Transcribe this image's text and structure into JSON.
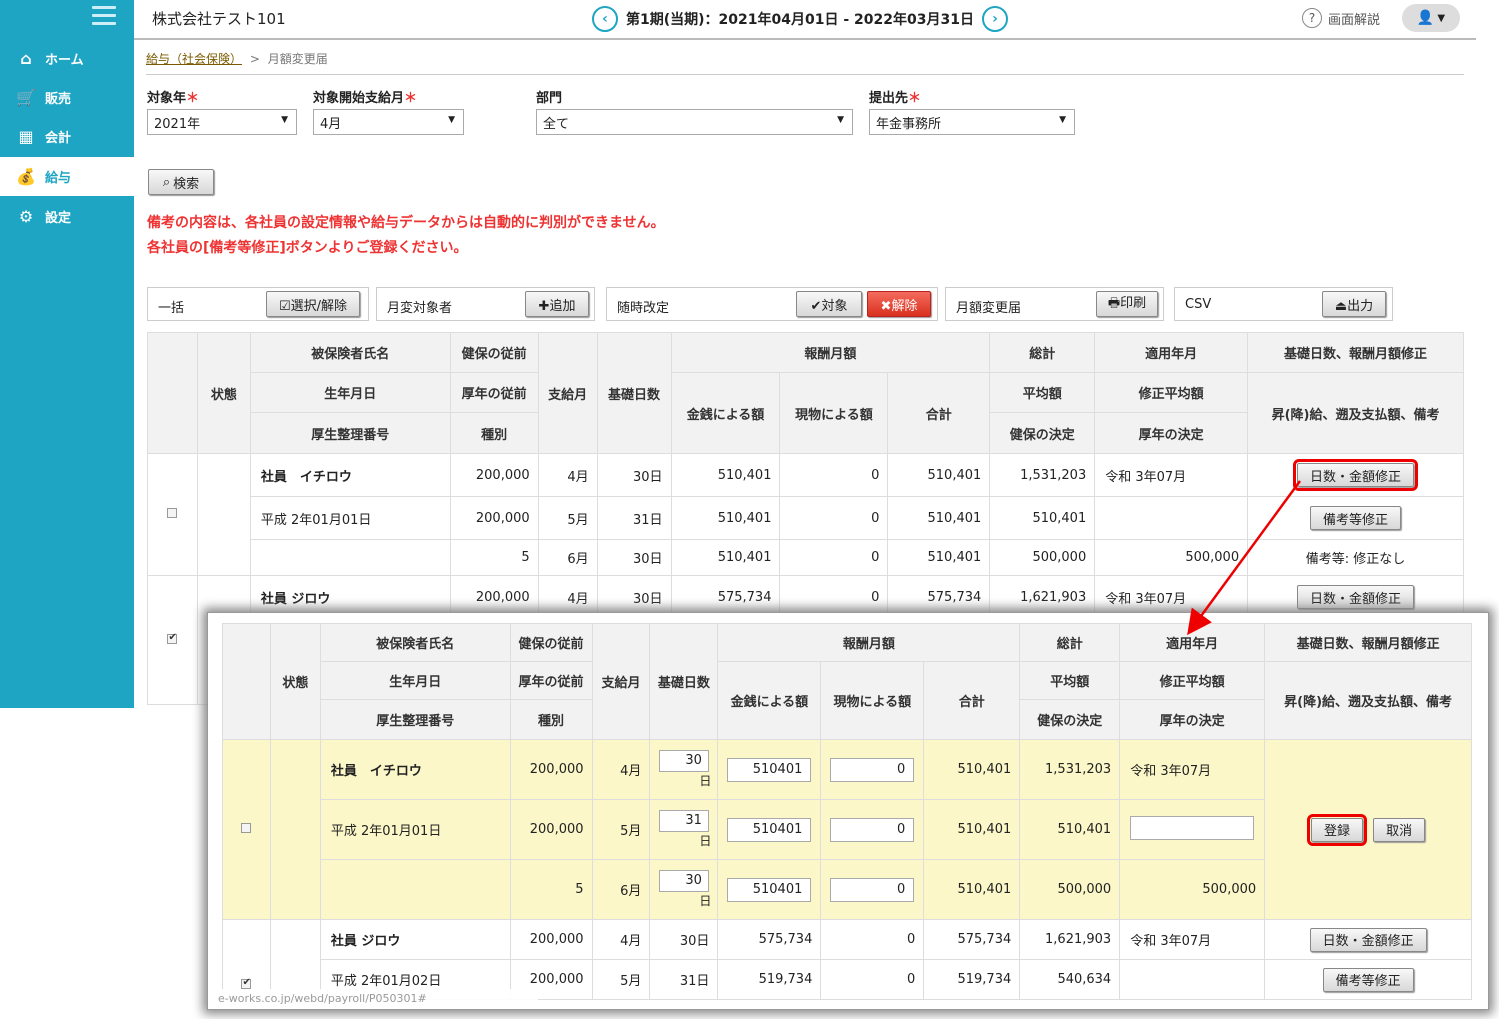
{
  "sidebar": {
    "items": [
      {
        "label": "ホーム",
        "icon": "home-icon"
      },
      {
        "label": "販売",
        "icon": "cart-icon"
      },
      {
        "label": "会計",
        "icon": "calculator-icon"
      },
      {
        "label": "給与",
        "icon": "money-bag-icon"
      },
      {
        "label": "設定",
        "icon": "gear-icon"
      }
    ]
  },
  "header": {
    "company": "株式会社テスト101",
    "period": "第1期(当期)：2021年04月01日 - 2022年03月31日",
    "help": "画面解説"
  },
  "breadcrumb": {
    "parent": "給与（社会保険）",
    "sep": ">",
    "current": "月額変更届"
  },
  "filters": {
    "year_label": "対象年",
    "year_value": "2021年",
    "month_label": "対象開始支給月",
    "month_value": "4月",
    "dept_label": "部門",
    "dept_value": "全て",
    "dest_label": "提出先",
    "dest_value": "年金事務所",
    "required_mark": "＊",
    "search": "検索"
  },
  "notice": {
    "line1": "備考の内容は、各社員の設定情報や給与データからは自動的に判別ができません。",
    "line2": "各社員の[備考等修正]ボタンよりご登録ください。"
  },
  "actions": {
    "bulk_label": "一括",
    "bulk_btn": "☑選択/解除",
    "target_label": "月変対象者",
    "target_btn": "✚追加",
    "revision_label": "随時改定",
    "revision_on": "✔対象",
    "revision_off": "✖解除",
    "form_label": "月額変更届",
    "form_btn": "🖶印刷",
    "csv_label": "CSV",
    "csv_btn": "⏏出力"
  },
  "table_headers": {
    "status": "状態",
    "name": "被保険者氏名",
    "birth": "生年月日",
    "number": "厚生整理番号",
    "kenpo_prev": "健保の従前",
    "kounen_prev": "厚年の従前",
    "kind": "種別",
    "pay_month": "支給月",
    "days": "基礎日数",
    "reward": "報酬月額",
    "cash": "金銭による額",
    "goods": "現物による額",
    "subtotal": "合計",
    "total": "総計",
    "avg": "平均額",
    "kenpo_dec": "健保の決定",
    "apply": "適用年月",
    "mod_avg": "修正平均額",
    "kounen_dec": "厚年の決定",
    "fix": "基礎日数、報酬月額修正",
    "fix2": "昇(降)給、遡及支払額、備考"
  },
  "employees": [
    {
      "name": "社員　イチロウ",
      "birth": "平成 2年01月01日",
      "number": "",
      "kenpo_prev": "200,000",
      "kounen_prev": "200,000",
      "kind": "5",
      "months": [
        "4月",
        "5月",
        "6月"
      ],
      "days": [
        "30日",
        "31日",
        "30日"
      ],
      "days_raw": [
        "30",
        "31",
        "30"
      ],
      "day_unit": "日",
      "cash": [
        "510,401",
        "510,401",
        "510,401"
      ],
      "cash_raw": [
        "510401",
        "510401",
        "510401"
      ],
      "goods": [
        "0",
        "0",
        "0"
      ],
      "subtotal": [
        "510,401",
        "510,401",
        "510,401"
      ],
      "total": "1,531,203",
      "avg": "510,401",
      "kenpo_dec": "500,000",
      "apply": "令和 3年07月",
      "mod_avg": "",
      "kounen_dec": "500,000",
      "btn_fix": "日数・金額修正",
      "btn_note": "備考等修正",
      "note": "備考等: 修正なし",
      "checked": false
    },
    {
      "name": "社員 ジロウ",
      "birth": "平成 2年01月02日",
      "kenpo_prev": "200,000",
      "kounen_prev": "200,000",
      "months": [
        "4月",
        "5月"
      ],
      "days": [
        "30日",
        "31日"
      ],
      "cash": [
        "575,734",
        "519,734"
      ],
      "goods": [
        "0",
        "0"
      ],
      "subtotal": [
        "575,734",
        "519,734"
      ],
      "total": "1,621,903",
      "avg": "540,634",
      "apply": "令和 3年07月",
      "btn_fix": "日数・金額修正",
      "btn_note": "備考等修正",
      "checked": true
    }
  ],
  "edit": {
    "save": "登録",
    "cancel": "取消"
  },
  "statusbar": "e-works.co.jp/webd/payroll/P050301#"
}
